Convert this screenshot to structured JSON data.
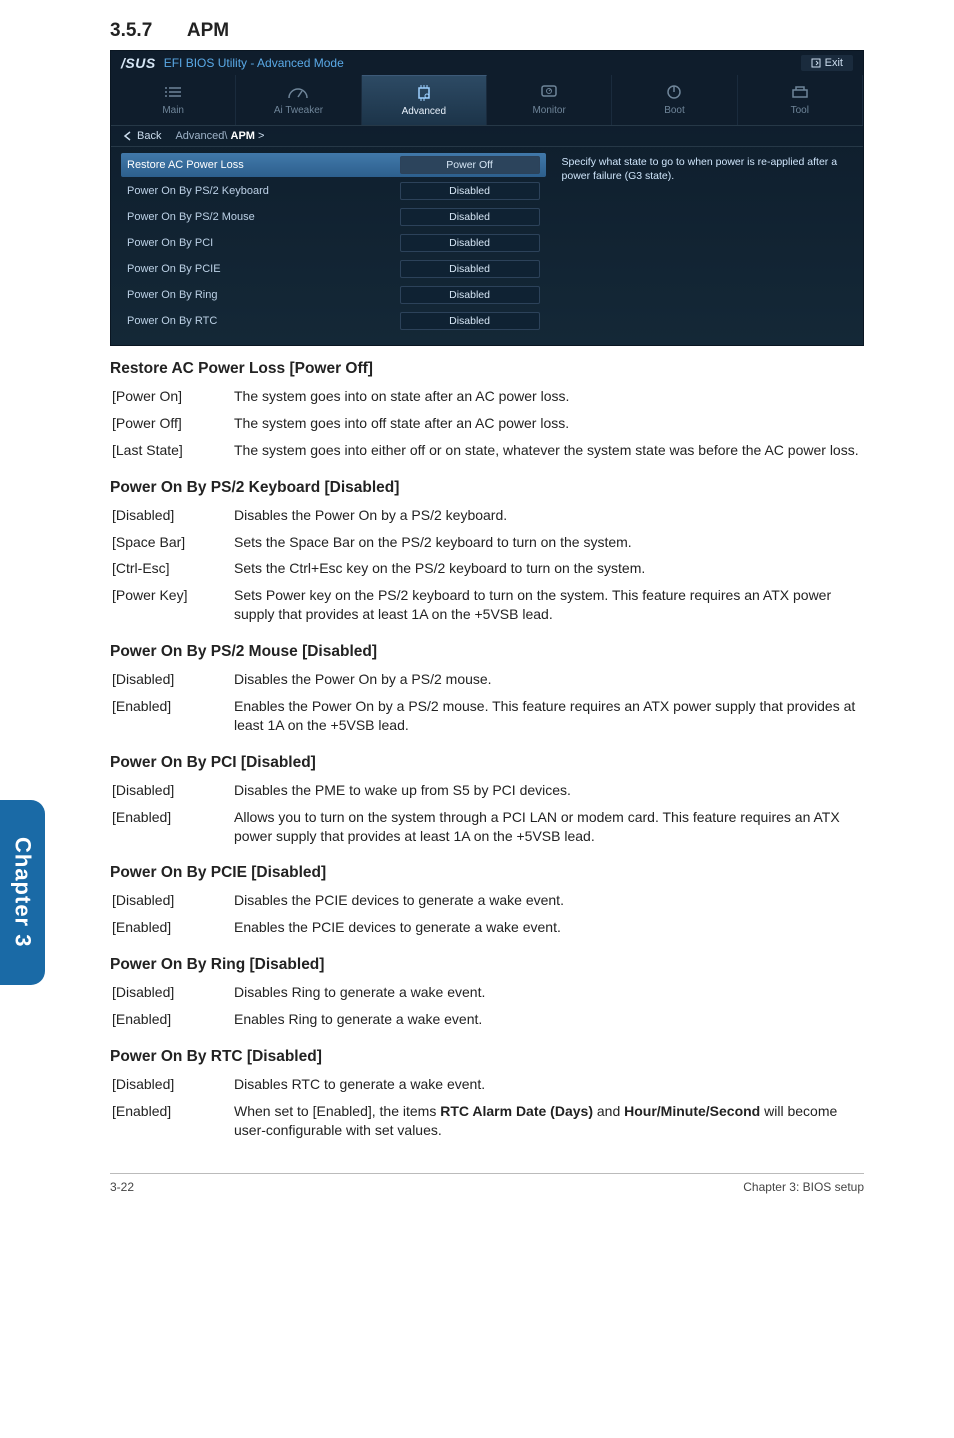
{
  "section": {
    "number": "3.5.7",
    "title": "APM"
  },
  "bios": {
    "title_prefix": "/SUS",
    "title_text": "EFI BIOS Utility - Advanced Mode",
    "exit_label": "Exit",
    "tabs": [
      {
        "key": "main",
        "label": "Main"
      },
      {
        "key": "ai",
        "label": "Ai Tweaker"
      },
      {
        "key": "advanced",
        "label": "Advanced"
      },
      {
        "key": "monitor",
        "label": "Monitor"
      },
      {
        "key": "boot",
        "label": "Boot"
      },
      {
        "key": "tool",
        "label": "Tool"
      }
    ],
    "back_label": "Back",
    "crumb_path": "Advanced\\",
    "crumb_leaf": "APM",
    "crumb_suffix": ">",
    "help_text": "Specify what state to go to when power is re-applied after a power failure (G3 state).",
    "rows": [
      {
        "label": "Restore AC Power Loss",
        "value": "Power Off",
        "selected": true
      },
      {
        "label": "Power On By PS/2 Keyboard",
        "value": "Disabled",
        "selected": false
      },
      {
        "label": "Power On By PS/2 Mouse",
        "value": "Disabled",
        "selected": false
      },
      {
        "label": "Power On By PCI",
        "value": "Disabled",
        "selected": false
      },
      {
        "label": "Power On By PCIE",
        "value": "Disabled",
        "selected": false
      },
      {
        "label": "Power On By Ring",
        "value": "Disabled",
        "selected": false
      },
      {
        "label": "Power On By RTC",
        "value": "Disabled",
        "selected": false
      }
    ]
  },
  "doc": {
    "h1": "Restore AC Power Loss [Power Off]",
    "h1_defs": [
      {
        "k": "[Power On]",
        "v": "The system goes into on state after an AC power loss."
      },
      {
        "k": "[Power Off]",
        "v": "The system goes into off state after an AC power loss."
      },
      {
        "k": "[Last State]",
        "v": "The system goes into either off or on state, whatever the system state was before the AC power loss."
      }
    ],
    "h2": "Power On By PS/2 Keyboard [Disabled]",
    "h2_defs": [
      {
        "k": "[Disabled]",
        "v": "Disables the Power On by a PS/2 keyboard."
      },
      {
        "k": "[Space Bar]",
        "v": "Sets the Space Bar on the PS/2 keyboard to turn on the system."
      },
      {
        "k": "[Ctrl-Esc]",
        "v": "Sets the Ctrl+Esc key on the PS/2 keyboard to turn on the system."
      },
      {
        "k": "[Power Key]",
        "v": "Sets Power key on the PS/2 keyboard to turn on the system. This feature requires an ATX power supply that provides at least 1A on the +5VSB lead."
      }
    ],
    "h3": "Power On By PS/2 Mouse [Disabled]",
    "h3_defs": [
      {
        "k": "[Disabled]",
        "v": "Disables the Power On by a PS/2 mouse."
      },
      {
        "k": "[Enabled]",
        "v": "Enables the Power On by a PS/2 mouse. This feature requires an ATX power supply that provides at least 1A on the +5VSB lead."
      }
    ],
    "h4": "Power On By PCI [Disabled]",
    "h4_defs": [
      {
        "k": "[Disabled]",
        "v": "Disables the PME to wake up from S5 by PCI devices."
      },
      {
        "k": "[Enabled]",
        "v": "Allows you to turn on the system through a PCI LAN or modem card. This feature requires an ATX power supply that provides at least 1A on the +5VSB lead."
      }
    ],
    "h5": "Power On By PCIE [Disabled]",
    "h5_defs": [
      {
        "k": "[Disabled]",
        "v": "Disables the PCIE devices to generate a wake event."
      },
      {
        "k": "[Enabled]",
        "v": "Enables the PCIE devices to generate a wake event."
      }
    ],
    "h6": "Power On By Ring [Disabled]",
    "h6_defs": [
      {
        "k": "[Disabled]",
        "v": "Disables Ring to generate a wake event."
      },
      {
        "k": "[Enabled]",
        "v": "Enables Ring to generate a wake event."
      }
    ],
    "h7": "Power On By RTC [Disabled]",
    "h7_defs": [
      {
        "k": "[Disabled]",
        "v": "Disables RTC to generate a wake event."
      }
    ],
    "h7_enabled_key": "[Enabled]",
    "h7_enabled_pre": "When set to [Enabled], the items ",
    "h7_enabled_bold1": "RTC Alarm Date (Days)",
    "h7_enabled_mid": " and ",
    "h7_enabled_bold2": "Hour/Minute/Second",
    "h7_enabled_post": " will become user-configurable with set values."
  },
  "side_tab": "Chapter 3",
  "footer": {
    "left": "3-22",
    "right": "Chapter 3: BIOS setup"
  }
}
